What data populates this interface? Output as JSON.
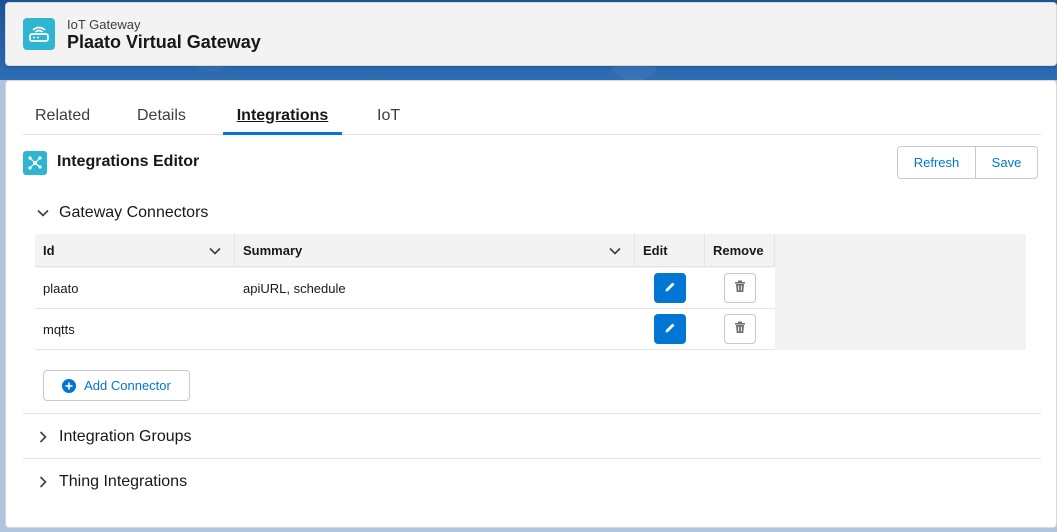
{
  "header": {
    "subtitle": "IoT Gateway",
    "title": "Plaato Virtual Gateway",
    "icon": "router-icon"
  },
  "tabs": [
    {
      "label": "Related",
      "active": false
    },
    {
      "label": "Details",
      "active": false
    },
    {
      "label": "Integrations",
      "active": true
    },
    {
      "label": "IoT",
      "active": false
    }
  ],
  "editor": {
    "title": "Integrations Editor",
    "icon": "network-icon",
    "refresh_label": "Refresh",
    "save_label": "Save"
  },
  "sections": {
    "connectors": {
      "label": "Gateway Connectors",
      "expanded": true
    },
    "groups": {
      "label": "Integration Groups",
      "expanded": false
    },
    "things": {
      "label": "Thing Integrations",
      "expanded": false
    }
  },
  "table": {
    "columns": [
      "Id",
      "Summary",
      "Edit",
      "Remove"
    ],
    "rows": [
      {
        "id": "plaato",
        "summary": "apiURL, schedule"
      },
      {
        "id": "mqtts",
        "summary": ""
      }
    ]
  },
  "add_connector_label": "Add Connector",
  "colors": {
    "brand": "#0176d3",
    "icon_bg": "#2fb5cf"
  }
}
